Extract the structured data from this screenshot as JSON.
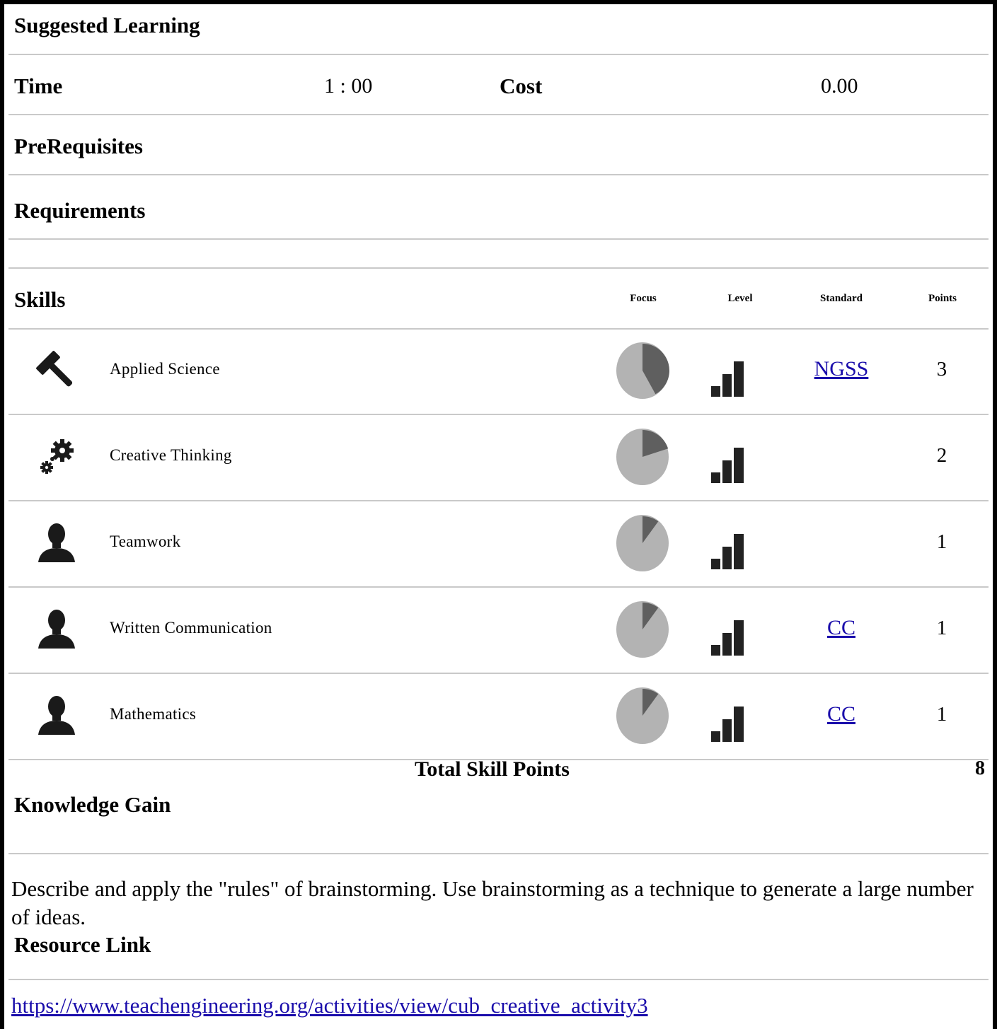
{
  "sections": {
    "suggested_learning": "Suggested Learning",
    "time_label": "Time",
    "time_value": "1 : 00",
    "cost_label": "Cost",
    "cost_value": "0.00",
    "prerequisites": "PreRequisites",
    "requirements": "Requirements"
  },
  "skills_table": {
    "title": "Skills",
    "columns": {
      "focus": "Focus",
      "level": "Level",
      "standard": "Standard",
      "points": "Points"
    },
    "rows": [
      {
        "icon": "hammer-icon",
        "name": "Applied Science",
        "focus": 0.42,
        "standard": "NGSS",
        "points": "3"
      },
      {
        "icon": "gears-icon",
        "name": "Creative Thinking",
        "focus": 0.2,
        "standard": "",
        "points": "2"
      },
      {
        "icon": "person-icon",
        "name": "Teamwork",
        "focus": 0.1,
        "standard": "",
        "points": "1"
      },
      {
        "icon": "person-icon",
        "name": "Written Communication",
        "focus": 0.1,
        "standard": "CC",
        "points": "1"
      },
      {
        "icon": "person-icon",
        "name": "Mathematics",
        "focus": 0.1,
        "standard": "CC",
        "points": "1"
      }
    ],
    "total_label": "Total Skill Points",
    "total_value": "8"
  },
  "knowledge": {
    "title": "Knowledge Gain",
    "text": "Describe and apply the \"rules\" of brainstorming. Use brainstorming as a technique to generate a large number of ideas."
  },
  "resource": {
    "title": "Resource Link",
    "url": "https://www.teachengineering.org/activities/view/cub_creative_activity3"
  },
  "colors": {
    "pie_light": "#b3b3b3",
    "pie_dark": "#5f5f5f",
    "link": "#1a0dab",
    "icon": "#1a1a1a"
  }
}
